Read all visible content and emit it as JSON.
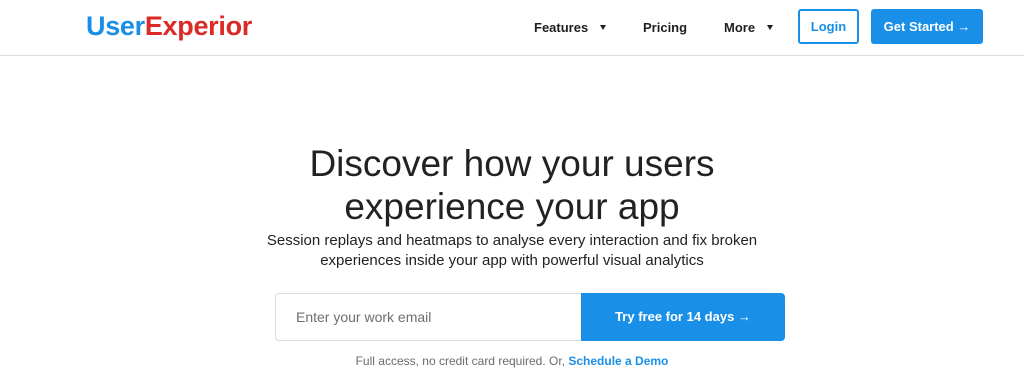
{
  "brand": {
    "name_part1": "User",
    "name_part2": "Experior",
    "color_part1": "#1a8fe8",
    "color_part2": "#dc2a27"
  },
  "nav": {
    "items": [
      {
        "label": "Features",
        "has_dropdown": true
      },
      {
        "label": "Pricing",
        "has_dropdown": false
      },
      {
        "label": "More",
        "has_dropdown": true
      }
    ],
    "login_label": "Login",
    "get_started_label": "Get Started →"
  },
  "hero": {
    "title_line1": "Discover how your users",
    "title_line2": "experience your app",
    "subtitle_line1": "Session replays and heatmaps to analyse every interaction and fix broken",
    "subtitle_line2": "experiences inside your app with powerful visual analytics",
    "email_placeholder": "Enter your work email",
    "email_value": "",
    "cta_label": "Try free for 14 days →",
    "note_text": "Full access, no credit card required. Or, ",
    "note_link": "Schedule a Demo"
  },
  "colors": {
    "accent": "#1a8fe8",
    "text": "#222222",
    "muted": "#6b6b6b"
  }
}
